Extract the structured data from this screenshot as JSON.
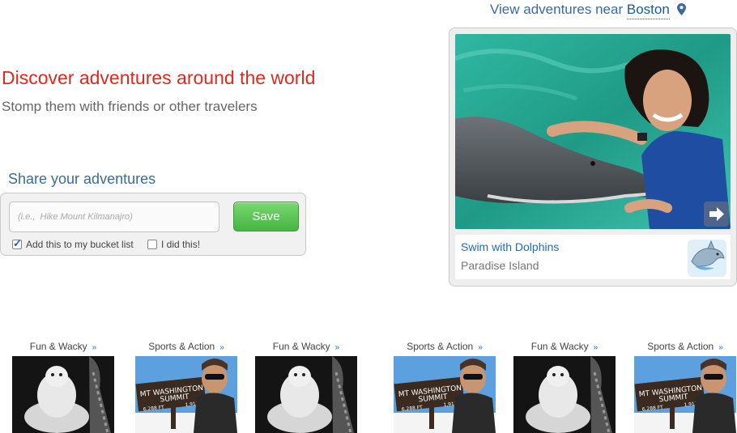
{
  "header": {
    "near_prefix": "View adventures near",
    "near_city": "Boston",
    "location_icon": "map-pin-icon"
  },
  "hero": {
    "headline": "Discover adventures around the world",
    "subline": "Stomp them with friends or other travelers"
  },
  "share": {
    "title": "Share your adventures",
    "placeholder": "(i.e.,  Hike Mount Kilmanajro)",
    "save_label": "Save",
    "bucket_list_label": "Add this to my bucket list",
    "bucket_list_checked": true,
    "did_it_label": "I did this!",
    "did_it_checked": false
  },
  "featured": {
    "title": "Swim with Dolphins",
    "location": "Paradise Island",
    "icon": "dolphin-icon",
    "next_icon": "arrow-right-icon"
  },
  "thumbnails": [
    {
      "category": "Fun & Wacky",
      "image": "snowman-photo"
    },
    {
      "category": "Sports & Action",
      "image": "mt-washington-photo"
    },
    {
      "category": "Fun & Wacky",
      "image": "snowman-photo"
    },
    {
      "category": "Sports & Action",
      "image": "mt-washington-photo"
    },
    {
      "category": "Fun & Wacky",
      "image": "snowman-photo"
    },
    {
      "category": "Sports & Action",
      "image": "mt-washington-photo"
    }
  ],
  "thumb_sign": {
    "line1": "MT WASHINGTON",
    "line2": "SUMMIT",
    "line3": "6,288 FT",
    "line4": "1,917"
  },
  "colors": {
    "headline": "#dd2a1f",
    "link_blue": "#1f6cc0",
    "save_green": "#44b543"
  }
}
